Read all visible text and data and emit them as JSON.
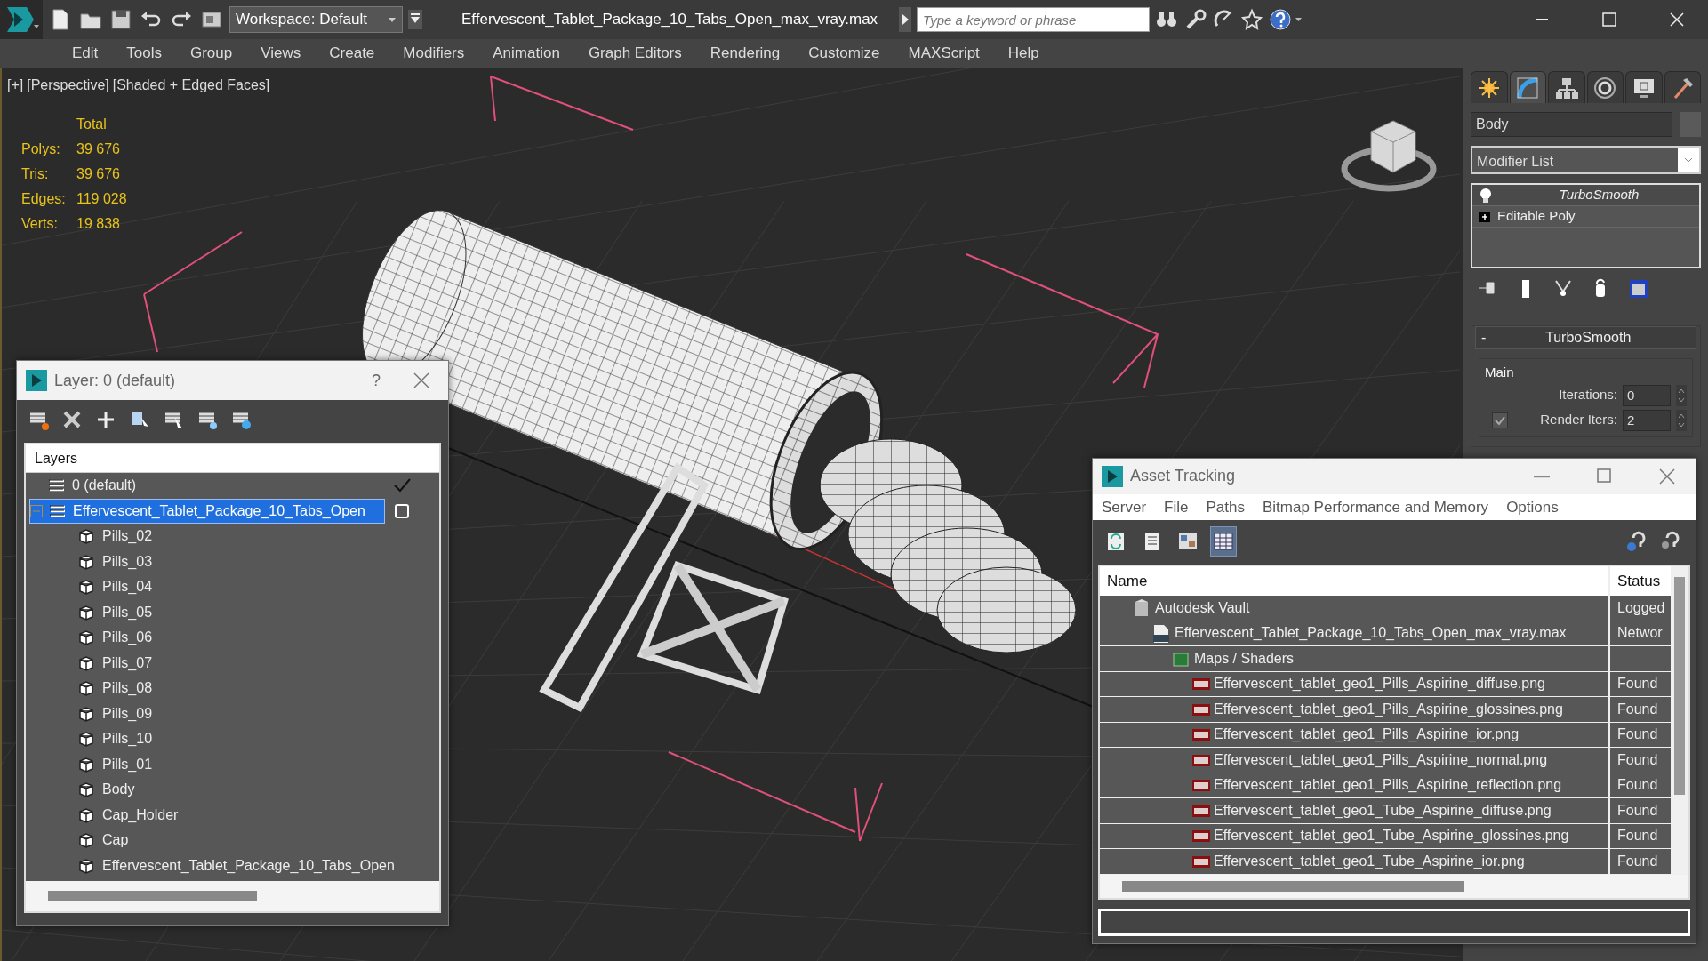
{
  "title_bar": {
    "workspace": "Workspace: Default",
    "title": "Effervescent_Tablet_Package_10_Tabs_Open_max_vray.max",
    "search": {
      "placeholder": "Type a keyword or phrase"
    }
  },
  "menu": [
    "Edit",
    "Tools",
    "Group",
    "Views",
    "Create",
    "Modifiers",
    "Animation",
    "Graph Editors",
    "Rendering",
    "Customize",
    "MAXScript",
    "Help"
  ],
  "viewport": {
    "labels": [
      "[+]",
      "[Perspective]",
      "[Shaded + Edged Faces]"
    ],
    "stats_heading": "Total",
    "stats": [
      {
        "label": "Polys:",
        "value": "39 676"
      },
      {
        "label": "Tris:",
        "value": "39 676"
      },
      {
        "label": "Edges:",
        "value": "119 028"
      },
      {
        "label": "Verts:",
        "value": "19 838"
      }
    ]
  },
  "command_panel": {
    "tabs": [
      {
        "selected": false
      },
      {
        "selected": true
      },
      {
        "selected": false
      },
      {
        "selected": false
      },
      {
        "selected": false
      },
      {
        "selected": false
      }
    ],
    "object_name": "Body",
    "modifier_list": "Modifier List",
    "stack": [
      {
        "kind": "modifier",
        "label": "TurboSmooth",
        "on": true
      },
      {
        "kind": "base",
        "label": "Editable Poly",
        "expanded": false
      }
    ],
    "rollout": {
      "toggle": "-",
      "title": "TurboSmooth",
      "group": "Main",
      "fields": [
        {
          "kind": "spinner",
          "label": "Iterations:",
          "value": "0"
        },
        {
          "kind": "check-spinner",
          "label": "Render Iters:",
          "value": "2",
          "checked": true
        }
      ]
    }
  },
  "layer_dialog": {
    "title": "Layer: 0 (default)",
    "help": "?",
    "column": "Layers",
    "layers": [
      {
        "label": "0 (default)",
        "selected": false,
        "current": true
      },
      {
        "label": "Effervescent_Tablet_Package_10_Tabs_Open",
        "selected": true,
        "current": false,
        "expanded": true,
        "children": [
          {
            "label": "Pills_02"
          },
          {
            "label": "Pills_03"
          },
          {
            "label": "Pills_04"
          },
          {
            "label": "Pills_05"
          },
          {
            "label": "Pills_06"
          },
          {
            "label": "Pills_07"
          },
          {
            "label": "Pills_08"
          },
          {
            "label": "Pills_09"
          },
          {
            "label": "Pills_10"
          },
          {
            "label": "Pills_01"
          },
          {
            "label": "Body"
          },
          {
            "label": "Cap_Holder"
          },
          {
            "label": "Cap"
          },
          {
            "label": "Effervescent_Tablet_Package_10_Tabs_Open"
          }
        ]
      }
    ]
  },
  "asset_tracking": {
    "title": "Asset Tracking",
    "menu": [
      "Server",
      "File",
      "Paths",
      "Bitmap Performance and Memory",
      "Options"
    ],
    "toolbar": [
      {
        "selected": false
      },
      {
        "selected": false
      },
      {
        "selected": false
      },
      {
        "selected": true
      }
    ],
    "columns": [
      "Name",
      "Status"
    ],
    "rows": [
      {
        "kind": "vault",
        "name": "Autodesk Vault",
        "status": "Logged",
        "children": [
          {
            "kind": "max",
            "name": "Effervescent_Tablet_Package_10_Tabs_Open_max_vray.max",
            "status": "Networ",
            "children": [
              {
                "kind": "folder",
                "name": "Maps / Shaders",
                "children": [
                  {
                    "kind": "png",
                    "name": "Effervescent_tablet_geo1_Pills_Aspirine_diffuse.png",
                    "status": "Found"
                  },
                  {
                    "kind": "png",
                    "name": "Effervescent_tablet_geo1_Pills_Aspirine_glossines.png",
                    "status": "Found"
                  },
                  {
                    "kind": "png",
                    "name": "Effervescent_tablet_geo1_Pills_Aspirine_ior.png",
                    "status": "Found"
                  },
                  {
                    "kind": "png",
                    "name": "Effervescent_tablet_geo1_Pills_Aspirine_normal.png",
                    "status": "Found"
                  },
                  {
                    "kind": "png",
                    "name": "Effervescent_tablet_geo1_Pills_Aspirine_reflection.png",
                    "status": "Found"
                  },
                  {
                    "kind": "png",
                    "name": "Effervescent_tablet_geo1_Tube_Aspirine_diffuse.png",
                    "status": "Found"
                  },
                  {
                    "kind": "png",
                    "name": "Effervescent_tablet_geo1_Tube_Aspirine_glossines.png",
                    "status": "Found"
                  },
                  {
                    "kind": "png",
                    "name": "Effervescent_tablet_geo1_Tube_Aspirine_ior.png",
                    "status": "Found"
                  }
                ]
              }
            ]
          }
        ]
      }
    ]
  }
}
